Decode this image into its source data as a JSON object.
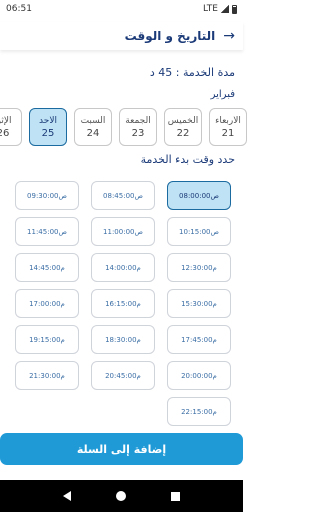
{
  "status_bar": {
    "time": "06:51",
    "network": "LTE"
  },
  "header": {
    "title": "التاريخ و الوقت"
  },
  "service": {
    "duration": "مدة الخدمة : 45 د"
  },
  "calendar": {
    "month": "فبراير",
    "days": [
      {
        "name": "الاربعاء",
        "number": "21"
      },
      {
        "name": "الخميس",
        "number": "22"
      },
      {
        "name": "الجمعة",
        "number": "23"
      },
      {
        "name": "السبت",
        "number": "24"
      },
      {
        "name": "الاحد",
        "number": "25"
      },
      {
        "name": "الإثن",
        "number": "26"
      }
    ],
    "selected_day": "25"
  },
  "slots_title": "حدد وقت بدء الخدمة",
  "slots": [
    "08:00:00ص",
    "08:45:00ص",
    "09:30:00ص",
    "10:15:00ص",
    "11:00:00ص",
    "11:45:00ص",
    "12:30:00م",
    "14:00:00م",
    "14:45:00م",
    "15:30:00م",
    "16:15:00م",
    "17:00:00م",
    "17:45:00م",
    "18:30:00م",
    "19:15:00م",
    "20:00:00م",
    "20:45:00م",
    "21:30:00م",
    "22:15:00م"
  ],
  "selected_slot": "08:00:00ص",
  "add_button": {
    "label": "إضافة إلى السلة"
  }
}
